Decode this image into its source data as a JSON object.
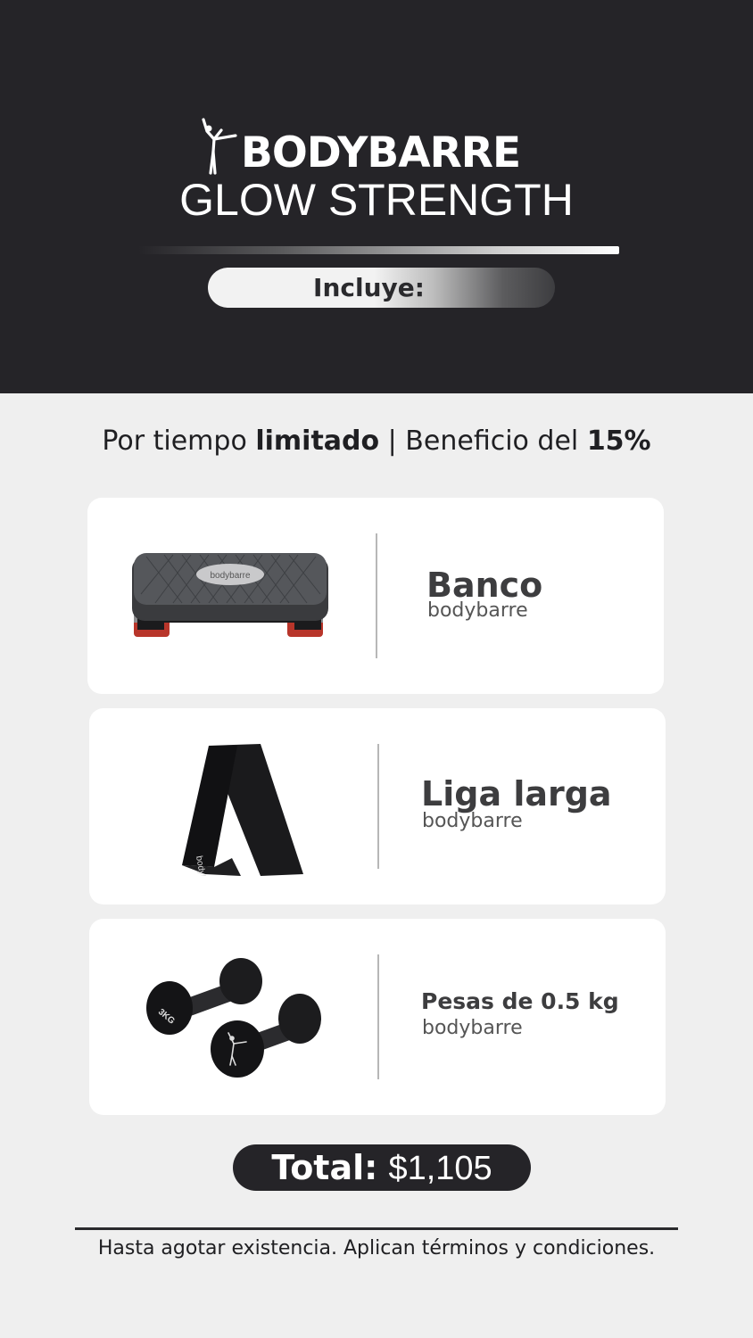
{
  "header": {
    "brand_name": "BODYBARRE",
    "logo_icon": "dancer-silhouette-icon",
    "subtitle": "GLOW STRENGTH",
    "includes_label": "Incluye:"
  },
  "promo": {
    "part1": "Por tiempo ",
    "bold1": "limitado",
    "part2": " | Beneficio del ",
    "bold2": "15%"
  },
  "products": [
    {
      "title": "Banco",
      "brand": "bodybarre",
      "icon": "step-bench-icon"
    },
    {
      "title": "Liga larga",
      "brand": "bodybarre",
      "icon": "resistance-band-icon"
    },
    {
      "title": "Pesas de 0.5 kg",
      "brand": "bodybarre",
      "icon": "dumbbells-icon"
    }
  ],
  "images": {
    "bench_logo": "bodybarre",
    "band_logo": "bodybarre",
    "dumbbell_weight": "3KG"
  },
  "total": {
    "label": "Total:",
    "amount": "$1,105"
  },
  "footer": {
    "disclaimer": "Hasta agotar existencia. Aplican términos y condiciones."
  },
  "colors": {
    "dark": "#252428",
    "background": "#efefef",
    "card": "#ffffff",
    "accent_red": "#b8352a"
  }
}
